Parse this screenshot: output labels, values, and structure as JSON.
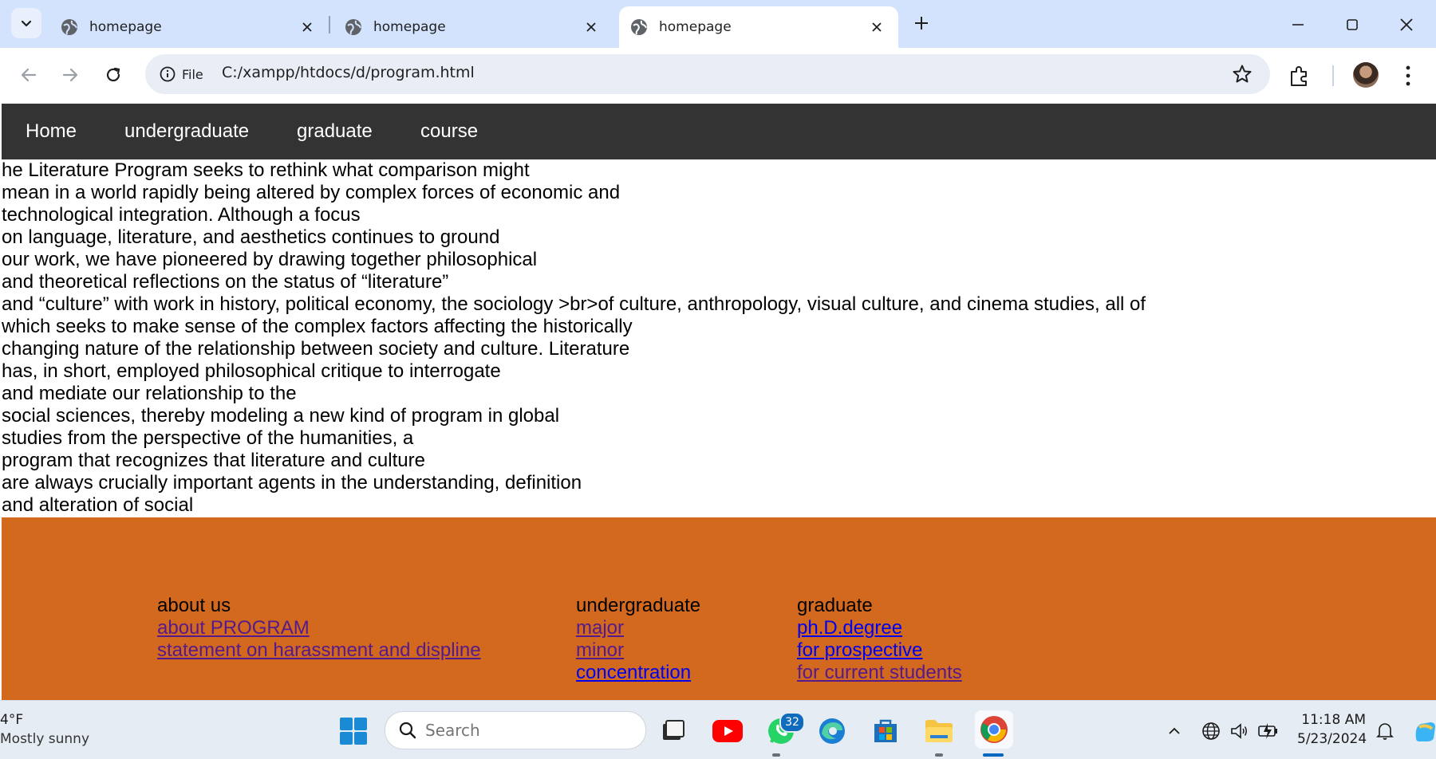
{
  "browser": {
    "tabs": [
      {
        "title": "homepage"
      },
      {
        "title": "homepage"
      },
      {
        "title": "homepage"
      }
    ],
    "address": {
      "scheme_chip": "File",
      "url": "C:/xampp/htdocs/d/program.html"
    }
  },
  "nav": {
    "items": [
      "Home",
      "undergraduate",
      "graduate",
      "course"
    ]
  },
  "content": {
    "lines": [
      "he Literature Program seeks to rethink what comparison might",
      "mean in a world rapidly being altered by complex forces of economic and",
      "technological integration. Although a focus",
      "on language, literature, and aesthetics continues to ground",
      "our work, we have pioneered by drawing together philosophical",
      "and theoretical reflections on the status of “literature”",
      "and “culture” with work in history, political economy, the sociology >br>of culture, anthropology, visual culture, and cinema studies, all of",
      "which seeks to make sense of the complex factors affecting the historically",
      "changing nature of the relationship between society and culture. Literature",
      "has, in short, employed philosophical critique to interrogate",
      "and mediate our relationship to the",
      "social sciences, thereby modeling a new kind of program in global",
      "studies from the perspective of the humanities, a",
      "program that recognizes that literature and culture",
      "are always crucially important agents in the understanding, definition",
      "and alteration of social"
    ]
  },
  "footer": {
    "about": {
      "heading": "about us",
      "links": [
        "about PROGRAM",
        "statement on harassment and displine"
      ]
    },
    "undergraduate": {
      "heading": "undergraduate",
      "links": [
        "major",
        "minor",
        "concentration"
      ]
    },
    "graduate": {
      "heading": "graduate",
      "links": [
        "ph.D.degree",
        "for prospective",
        "for current students"
      ]
    }
  },
  "taskbar": {
    "weather": {
      "temp": "4°F",
      "desc": "Mostly sunny"
    },
    "search_placeholder": "Search",
    "whatsapp_badge": "32",
    "time": "11:18 AM",
    "date": "5/23/2024"
  },
  "colors": {
    "tabstrip": "#d3e3fd",
    "nav_bg": "#333333",
    "footer_bg": "#d2691e",
    "link_visited": "#551a8b",
    "link_unvisited": "#0000ee"
  }
}
